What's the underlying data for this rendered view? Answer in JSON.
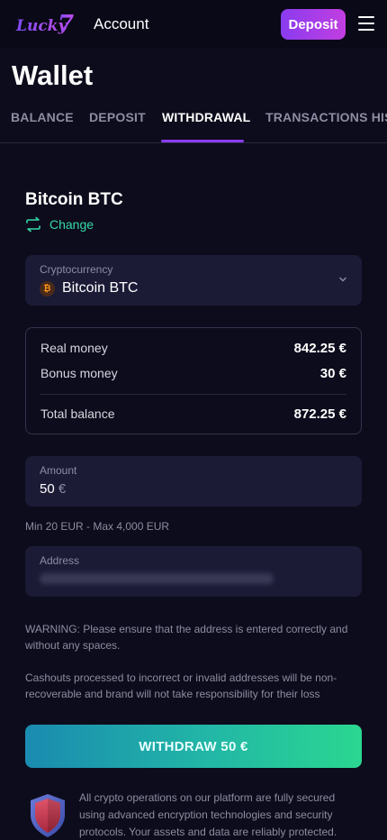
{
  "header": {
    "logo_text": "Lucky7",
    "title": "Account",
    "deposit_label": "Deposit",
    "menu_icon": "hamburger-menu-icon"
  },
  "page": {
    "title": "Wallet"
  },
  "tabs": [
    {
      "label": "BALANCE",
      "active": false
    },
    {
      "label": "DEPOSIT",
      "active": false
    },
    {
      "label": "WITHDRAWAL",
      "active": true
    },
    {
      "label": "TRANSACTIONS HIS",
      "active": false
    }
  ],
  "withdrawal": {
    "coin_title": "Bitcoin BTC",
    "change_label": "Change",
    "change_icon": "swap-arrows-icon",
    "crypto_select": {
      "label": "Cryptocurrency",
      "value": "Bitcoin BTC",
      "coin_glyph": "₿"
    },
    "balance": {
      "real_label": "Real money",
      "real_value": "842.25 €",
      "bonus_label": "Bonus money",
      "bonus_value": "30 €",
      "total_label": "Total balance",
      "total_value": "872.25 €"
    },
    "amount": {
      "label": "Amount",
      "value": "50",
      "currency": "€"
    },
    "limits": "Min 20 EUR - Max 4,000 EUR",
    "address": {
      "label": "Address"
    },
    "warning": "WARNING: Please ensure that the address is entered correctly and without any spaces.",
    "cashout_note": "Cashouts processed to incorrect or invalid addresses will be non-recoverable and brand will not take responsibility for their loss",
    "withdraw_button": "WITHDRAW 50 €",
    "security_note": "All crypto operations on our platform are fully secured using advanced encryption technologies and security protocols. Your assets and data are reliably protected."
  },
  "colors": {
    "background": "#0d0c1c",
    "accent_purple": "#8a3cf0",
    "accent_green": "#35d9a8",
    "field_bg": "#1c1b36"
  }
}
